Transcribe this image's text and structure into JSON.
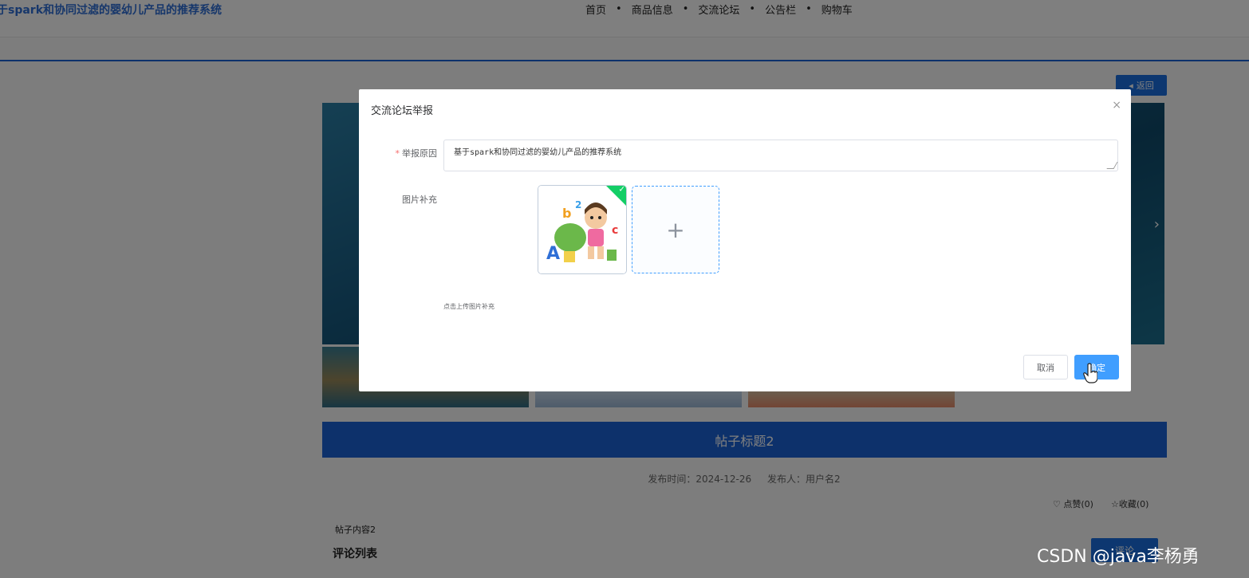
{
  "header": {
    "site_title": "于spark和协同过滤的婴幼儿产品的推荐系统",
    "nav": [
      "首页",
      "商品信息",
      "交流论坛",
      "公告栏",
      "购物车"
    ],
    "nav_separator": "•"
  },
  "detail": {
    "back_label": "返回",
    "post_title": "帖子标题2",
    "publish_time_label": "发布时间：2024-12-26",
    "publisher_label": "发布人：用户名2",
    "like_label": "点赞(0)",
    "favorite_label": "收藏(0)",
    "content": "帖子内容2",
    "comments_title": "评论列表",
    "comment_button": "评论"
  },
  "dialog": {
    "title": "交流论坛举报",
    "close_glyph": "×",
    "reason_label": "举报原因",
    "reason_value": "基于spark和协同过滤的婴幼儿产品的推荐系统",
    "image_label": "图片补充",
    "upload_add_glyph": "+",
    "upload_tip": "点击上传图片补充",
    "cancel_label": "取消",
    "confirm_label": "确定",
    "upload_success_check": "✓"
  },
  "watermark": "CSDN @java李杨勇",
  "colors": {
    "primary": "#409eff",
    "brand_blue": "#1a63d6",
    "success": "#13ce66",
    "required": "#f56c6c"
  }
}
